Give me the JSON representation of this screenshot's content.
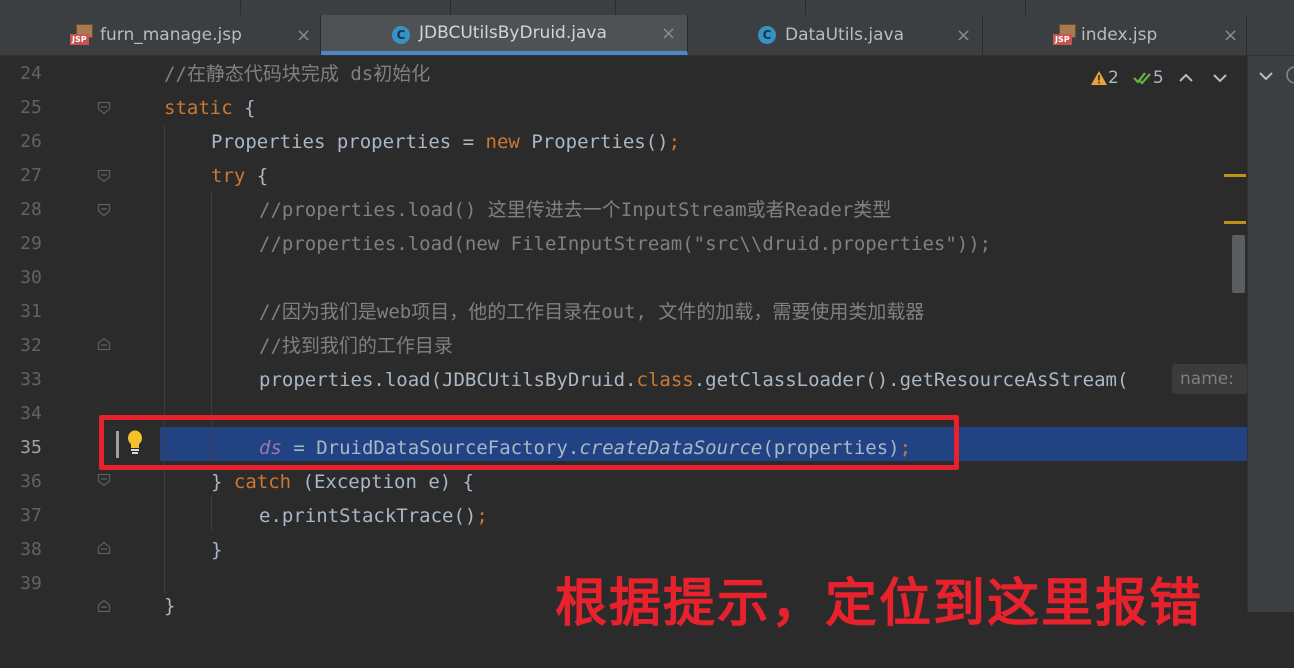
{
  "tabs": [
    {
      "name": "furn_manage.jsp",
      "icon": "jsp-file-icon",
      "active": false
    },
    {
      "name": "JDBCUtilsByDruid.java",
      "icon": "java-class-icon",
      "active": true
    },
    {
      "name": "DataUtils.java",
      "icon": "java-class-icon",
      "active": false
    },
    {
      "name": "index.jsp",
      "icon": "jsp-file-icon",
      "active": false
    }
  ],
  "close_glyph": "×",
  "inspections": {
    "warnings": "2",
    "ok": "5"
  },
  "line_numbers": [
    "24",
    "25",
    "26",
    "27",
    "28",
    "29",
    "30",
    "31",
    "32",
    "33",
    "34",
    "35",
    "36",
    "37",
    "38",
    "39"
  ],
  "current_line": "35",
  "code": {
    "l24": "//在静态代码块完成 ds初始化",
    "l25_kw": "static",
    "l25_rest": " {",
    "l26_a": "Properties properties = ",
    "l26_new": "new",
    "l26_b": " Properties()",
    "l26_semi": ";",
    "l27_kw": "try",
    "l27_rest": " {",
    "l28": "//properties.load() 这里传进去一个InputStream或者Reader类型",
    "l29": "//properties.load(new FileInputStream(\"src\\\\druid.properties\"));",
    "l31": "//因为我们是web项目，他的工作目录在out, 文件的加载，需要使用类加载器",
    "l32": "//找到我们的工作目录",
    "l33_a": "properties.load(JDBCUtilsByDruid.",
    "l33_kw": "class",
    "l33_b": ".getClassLoader().getResourceAsStream(",
    "l33_hint": "name:",
    "l35_fld": "ds",
    "l35_a": " = DruidDataSourceFactory.",
    "l35_method": "createDataSource",
    "l35_b": "(properties)",
    "l35_semi": ";",
    "l36_a": "} ",
    "l36_kw": "catch",
    "l36_b": " (Exception e) {",
    "l37_a": "e.printStackTrace()",
    "l37_semi": ";",
    "l38": "}",
    "l40": "}"
  },
  "annotation": "根据提示，定位到这里报错",
  "colors": {
    "editor_bg": "#2b2b2b",
    "highlight_line": "#214283",
    "annotation_red": "#e8222d",
    "keyword": "#cc7832",
    "comment": "#808080",
    "field": "#9876aa",
    "active_tab_underline": "#4a88c7"
  }
}
